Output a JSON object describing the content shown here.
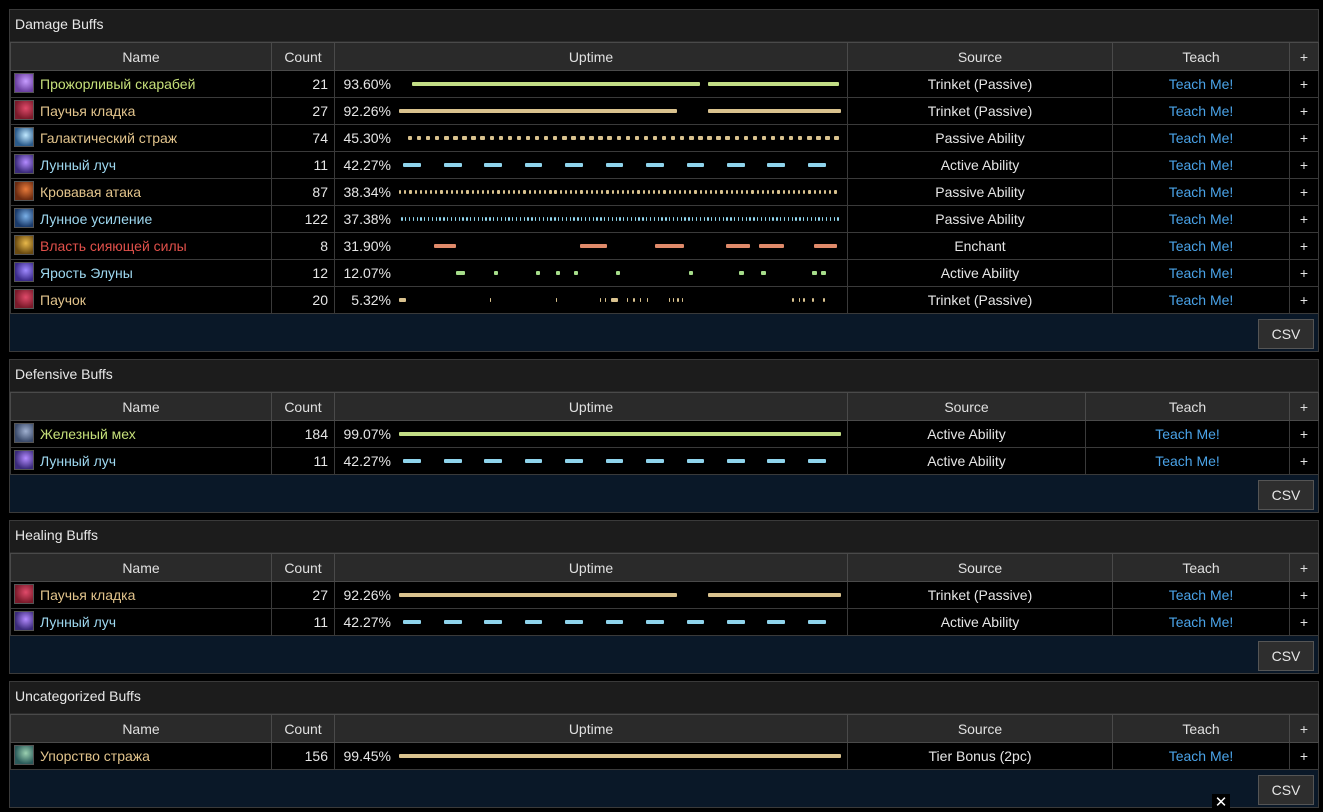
{
  "columns": {
    "name": "Name",
    "count": "Count",
    "uptime": "Uptime",
    "source": "Source",
    "teach": "Teach",
    "plus": "+"
  },
  "csv_label": "CSV",
  "close_label": "✕",
  "panels": [
    {
      "title": "Damage Buffs",
      "rows": [
        {
          "name": "Прожорливый скарабей",
          "color": "#c6e07a",
          "icon": "scarab-icon",
          "icon_colors": [
            "#6a3fa0",
            "#c79cff"
          ],
          "count": "21",
          "uptime": "93.60%",
          "source": "Trinket (Passive)",
          "teach": "Teach Me!",
          "bar_color": "#c2dd85",
          "segments": [
            [
              0.03,
              0.68
            ],
            [
              0.7,
              0.995
            ]
          ]
        },
        {
          "name": "Паучья кладка",
          "color": "#e2c48c",
          "icon": "spider-egg-icon",
          "icon_colors": [
            "#7a1a2a",
            "#e04a6a"
          ],
          "count": "27",
          "uptime": "92.26%",
          "source": "Trinket (Passive)",
          "teach": "Teach Me!",
          "bar_color": "#d9c28e",
          "segments": [
            [
              0.0,
              0.63
            ],
            [
              0.7,
              1.0
            ]
          ]
        },
        {
          "name": "Галактический страж",
          "color": "#e2c48c",
          "icon": "galactic-guardian-icon",
          "icon_colors": [
            "#2a5a8a",
            "#bfe8ff"
          ],
          "count": "74",
          "uptime": "45.30%",
          "source": "Passive Ability",
          "teach": "Teach Me!",
          "bar_color": "#d9c28e",
          "dashes": {
            "n": 48,
            "start": 0.02,
            "end": 0.995,
            "w": 0.01
          }
        },
        {
          "name": "Лунный луч",
          "color": "#9ed8f0",
          "icon": "moonfire-icon",
          "icon_colors": [
            "#3a2a7a",
            "#b38aff"
          ],
          "count": "11",
          "uptime": "42.27%",
          "source": "Active Ability",
          "teach": "Teach Me!",
          "bar_color": "#8fd4ec",
          "dashes": {
            "n": 11,
            "start": 0.01,
            "end": 0.965,
            "w": 0.04
          }
        },
        {
          "name": "Кровавая атака",
          "color": "#e2c48c",
          "icon": "bloody-attack-icon",
          "icon_colors": [
            "#6a2a10",
            "#e87a3a"
          ],
          "count": "87",
          "uptime": "38.34%",
          "source": "Passive Ability",
          "teach": "Teach Me!",
          "bar_color": "#d9c28e",
          "dashes": {
            "n": 85,
            "start": 0.0,
            "end": 0.99,
            "w": 0.005
          }
        },
        {
          "name": "Лунное усиление",
          "color": "#9ed8f0",
          "icon": "lunar-empowerment-icon",
          "icon_colors": [
            "#1a3a6a",
            "#7ab0e8"
          ],
          "count": "122",
          "uptime": "37.38%",
          "source": "Passive Ability",
          "teach": "Teach Me!",
          "bar_color": "#8fd4ec",
          "dashes": {
            "n": 115,
            "start": 0.005,
            "end": 0.995,
            "w": 0.003
          }
        },
        {
          "name": "Власть сияющей силы",
          "color": "#e0504a",
          "icon": "radiant-power-icon",
          "icon_colors": [
            "#6a4a10",
            "#e8b84a"
          ],
          "count": "8",
          "uptime": "31.90%",
          "source": "Enchant",
          "teach": "Teach Me!",
          "bar_color": "#e08a6a",
          "segments": [
            [
              0.08,
              0.13
            ],
            [
              0.41,
              0.47
            ],
            [
              0.58,
              0.645
            ],
            [
              0.74,
              0.795
            ],
            [
              0.815,
              0.87
            ],
            [
              0.94,
              0.99
            ]
          ]
        },
        {
          "name": "Ярость Элуны",
          "color": "#9ed8f0",
          "icon": "fury-of-elune-icon",
          "icon_colors": [
            "#3a2a8a",
            "#a08aff"
          ],
          "count": "12",
          "uptime": "12.07%",
          "source": "Active Ability",
          "teach": "Teach Me!",
          "bar_color": "#a6dd8a",
          "segments": [
            [
              0.13,
              0.15
            ],
            [
              0.215,
              0.225
            ],
            [
              0.31,
              0.32
            ],
            [
              0.355,
              0.365
            ],
            [
              0.395,
              0.405
            ],
            [
              0.49,
              0.5
            ],
            [
              0.655,
              0.665
            ],
            [
              0.77,
              0.78
            ],
            [
              0.82,
              0.83
            ],
            [
              0.935,
              0.945
            ],
            [
              0.955,
              0.965
            ]
          ]
        },
        {
          "name": "Паучок",
          "color": "#e2c48c",
          "icon": "spiderling-icon",
          "icon_colors": [
            "#7a1a2a",
            "#e04a6a"
          ],
          "count": "20",
          "uptime": "5.32%",
          "source": "Trinket (Passive)",
          "teach": "Teach Me!",
          "bar_color": "#d9c28e",
          "segments": [
            [
              0.0,
              0.015
            ],
            [
              0.205,
              0.208
            ],
            [
              0.355,
              0.358
            ],
            [
              0.455,
              0.458
            ],
            [
              0.465,
              0.468
            ],
            [
              0.48,
              0.495
            ],
            [
              0.515,
              0.518
            ],
            [
              0.53,
              0.533
            ],
            [
              0.545,
              0.548
            ],
            [
              0.56,
              0.563
            ],
            [
              0.61,
              0.613
            ],
            [
              0.62,
              0.623
            ],
            [
              0.63,
              0.633
            ],
            [
              0.64,
              0.643
            ],
            [
              0.89,
              0.893
            ],
            [
              0.905,
              0.908
            ],
            [
              0.915,
              0.918
            ],
            [
              0.935,
              0.938
            ],
            [
              0.96,
              0.963
            ]
          ]
        }
      ]
    },
    {
      "title": "Defensive Buffs",
      "rows": [
        {
          "name": "Железный мех",
          "color": "#c6e07a",
          "icon": "ironfur-icon",
          "icon_colors": [
            "#3a4a6a",
            "#a0b0d0"
          ],
          "count": "184",
          "uptime": "99.07%",
          "source": "Active Ability",
          "teach": "Teach Me!",
          "bar_color": "#c2dd85",
          "segments": [
            [
              0.0,
              1.0
            ]
          ]
        },
        {
          "name": "Лунный луч",
          "color": "#9ed8f0",
          "icon": "moonfire-icon",
          "icon_colors": [
            "#3a2a7a",
            "#b38aff"
          ],
          "count": "11",
          "uptime": "42.27%",
          "source": "Active Ability",
          "teach": "Teach Me!",
          "bar_color": "#8fd4ec",
          "dashes": {
            "n": 11,
            "start": 0.01,
            "end": 0.965,
            "w": 0.04
          }
        }
      ]
    },
    {
      "title": "Healing Buffs",
      "rows": [
        {
          "name": "Паучья кладка",
          "color": "#e2c48c",
          "icon": "spider-egg-icon",
          "icon_colors": [
            "#7a1a2a",
            "#e04a6a"
          ],
          "count": "27",
          "uptime": "92.26%",
          "source": "Trinket (Passive)",
          "teach": "Teach Me!",
          "bar_color": "#d9c28e",
          "segments": [
            [
              0.0,
              0.63
            ],
            [
              0.7,
              1.0
            ]
          ]
        },
        {
          "name": "Лунный луч",
          "color": "#9ed8f0",
          "icon": "moonfire-icon",
          "icon_colors": [
            "#3a2a7a",
            "#b38aff"
          ],
          "count": "11",
          "uptime": "42.27%",
          "source": "Active Ability",
          "teach": "Teach Me!",
          "bar_color": "#8fd4ec",
          "dashes": {
            "n": 11,
            "start": 0.01,
            "end": 0.965,
            "w": 0.04
          }
        }
      ]
    },
    {
      "title": "Uncategorized Buffs",
      "rows": [
        {
          "name": "Упорство стража",
          "color": "#e2c48c",
          "icon": "guardian-persistence-icon",
          "icon_colors": [
            "#2a5a5a",
            "#9ad0b0"
          ],
          "count": "156",
          "uptime": "99.45%",
          "source": "Tier Bonus (2pc)",
          "teach": "Teach Me!",
          "bar_color": "#d9c28e",
          "segments": [
            [
              0.0,
              1.0
            ]
          ]
        }
      ]
    }
  ]
}
